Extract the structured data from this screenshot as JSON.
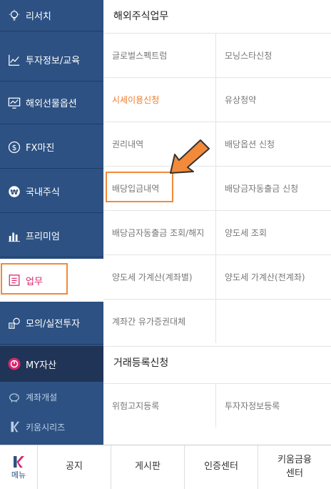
{
  "sidebar": {
    "items": [
      {
        "label": "리서치",
        "icon": "bulb-icon"
      },
      {
        "label": "투자정보/교육",
        "icon": "chart-line-icon"
      },
      {
        "label": "해외선물옵션",
        "icon": "monitor-chart-icon"
      },
      {
        "label": "FX마진",
        "icon": "dollar-icon"
      },
      {
        "label": "국내주식",
        "icon": "won-icon"
      },
      {
        "label": "프리미엄",
        "icon": "bar-chart-icon"
      },
      {
        "label": "업무",
        "icon": "checklist-icon"
      },
      {
        "label": "모의/실전투자",
        "icon": "coin-stack-icon"
      },
      {
        "label": "MY자산",
        "icon": "pie-icon"
      },
      {
        "label": "계좌개설",
        "icon": "piggy-icon"
      },
      {
        "label": "키움시리즈",
        "icon": "k-logo-icon"
      }
    ]
  },
  "main": {
    "section1_title": "해외주식업무",
    "grid1": [
      [
        "글로벌스펙트럼",
        "모닝스타신청"
      ],
      [
        "시세이용신청",
        "유상청약"
      ],
      [
        "권리내역",
        "배당옵션 신청"
      ],
      [
        "배당입금내역",
        "배당금자동출금 신청"
      ],
      [
        "배당금자동출금 조회/해지",
        "양도세 조회"
      ],
      [
        "양도세 가계산(계좌별)",
        "양도세 가계산(전계좌)"
      ],
      [
        "계좌간 유가증권대체",
        ""
      ]
    ],
    "section2_title": "거래등록신청",
    "grid2": [
      [
        "위험고지등록",
        "투자자정보등록"
      ]
    ]
  },
  "bottom_nav": {
    "menu_label": "메뉴",
    "items": [
      "공지",
      "게시판",
      "인증센터",
      "키움금융\n센터"
    ]
  },
  "colors": {
    "sidebar": "#2d5182",
    "active_text": "#d6266b",
    "highlight": "#f08a3a",
    "orange_text": "#f07a28"
  }
}
